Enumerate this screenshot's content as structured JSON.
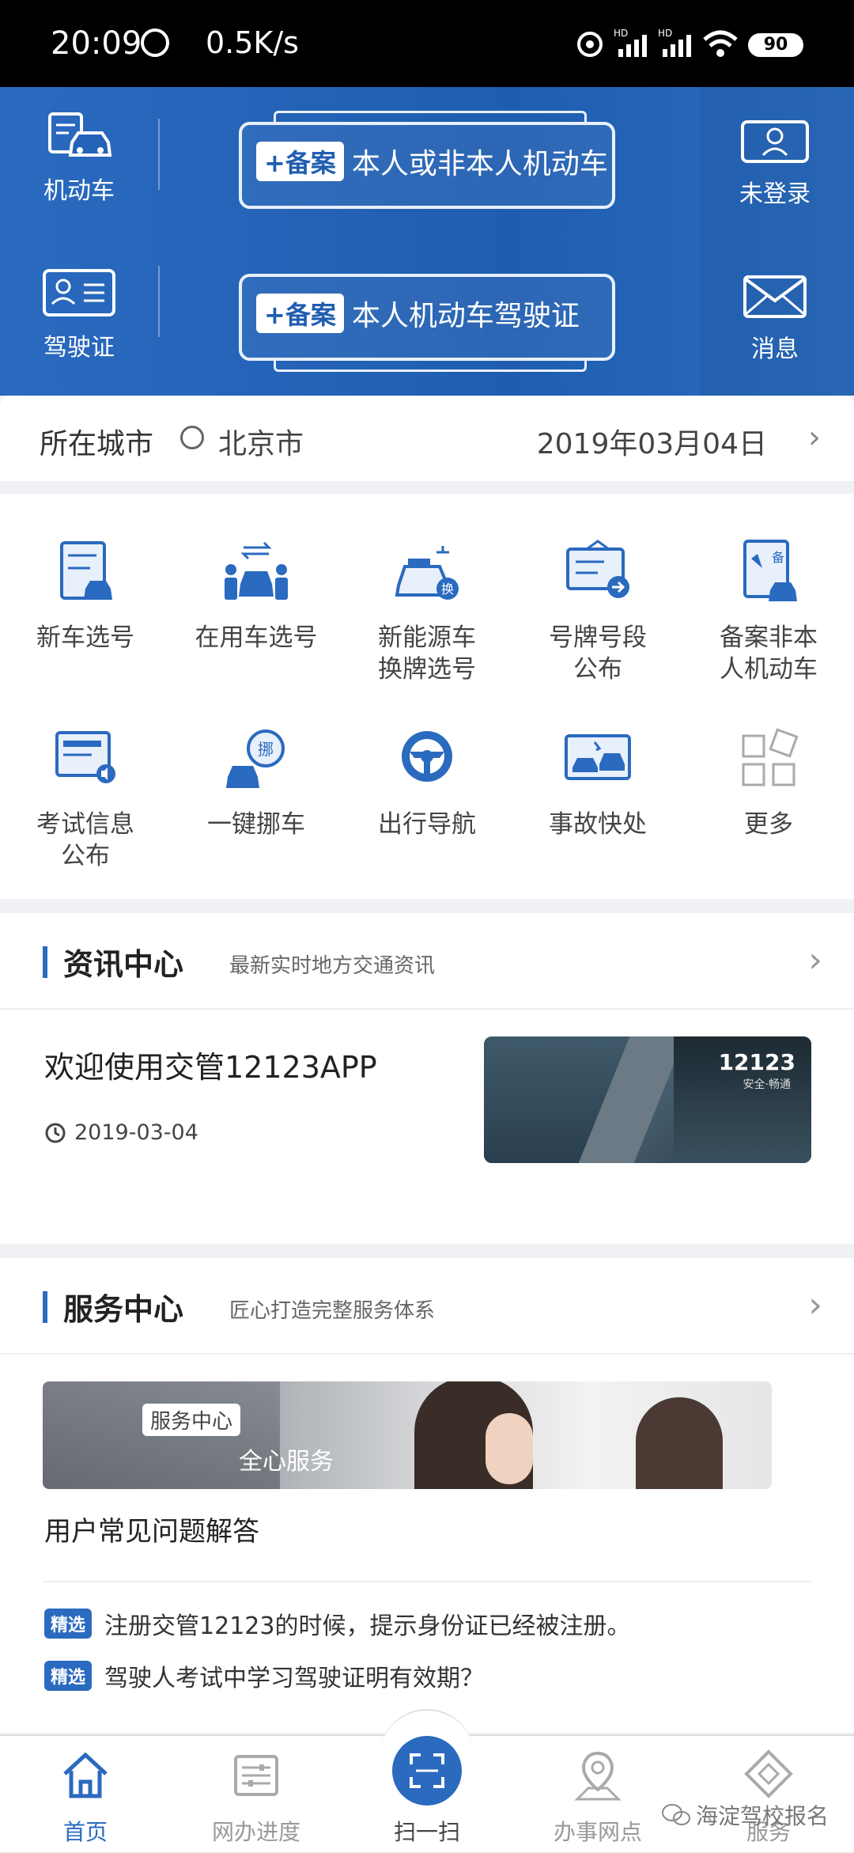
{
  "status_bar": {
    "time": "20:09",
    "speed": "0.5K/s",
    "signal1": "HD",
    "signal2": "HD",
    "battery": "90"
  },
  "header": {
    "vehicle_label": "机动车",
    "license_label": "驾驶证",
    "login_label": "未登录",
    "message_label": "消息",
    "plate1_tag": "+备案",
    "plate1_text": "本人或非本人机动车",
    "plate2_tag": "+备案",
    "plate2_text": "本人机动车驾驶证"
  },
  "city_bar": {
    "label": "所在城市",
    "city": "北京市",
    "date": "2019年03月04日"
  },
  "services": [
    {
      "label": "新车选号",
      "icon": "new-car-number-icon"
    },
    {
      "label": "在用车选号",
      "icon": "used-car-number-icon"
    },
    {
      "label": "新能源车\n换牌选号",
      "icon": "new-energy-car-icon"
    },
    {
      "label": "号牌号段\n公布",
      "icon": "plate-range-icon"
    },
    {
      "label": "备案非本\n人机动车",
      "icon": "register-vehicle-icon"
    },
    {
      "label": "考试信息\n公布",
      "icon": "exam-info-icon"
    },
    {
      "label": "一键挪车",
      "icon": "move-car-icon"
    },
    {
      "label": "出行导航",
      "icon": "steering-wheel-icon"
    },
    {
      "label": "事故快处",
      "icon": "accident-icon"
    },
    {
      "label": "更多",
      "icon": "more-icon"
    }
  ],
  "news": {
    "title": "资讯中心",
    "subtitle": "最新实时地方交通资讯",
    "item_title": "欢迎使用交管12123APP",
    "item_date": "2019-03-04",
    "thumb_text": "12123",
    "thumb_sub": "安全·畅通"
  },
  "service_center": {
    "title": "服务中心",
    "subtitle": "匠心打造完整服务体系",
    "banner_tag": "服务中心",
    "banner_text": "全心服务",
    "faq_title": "用户常见问题解答",
    "faqs": [
      {
        "badge": "精选",
        "text": "注册交管12123的时候，提示身份证已经被注册。"
      },
      {
        "badge": "精选",
        "text": "驾驶人考试中学习驾驶证明有效期？"
      }
    ]
  },
  "tabs": [
    {
      "label": "首页",
      "icon": "home-icon"
    },
    {
      "label": "网办进度",
      "icon": "progress-icon"
    },
    {
      "label": "扫一扫",
      "icon": "scan-icon"
    },
    {
      "label": "办事网点",
      "icon": "location-icon"
    },
    {
      "label": "服务",
      "icon": "service-icon"
    }
  ],
  "watermark": "海淀驾校报名",
  "colors": {
    "primary": "#2a6abf",
    "header_bg": "#1f5db0",
    "text": "#333333"
  }
}
